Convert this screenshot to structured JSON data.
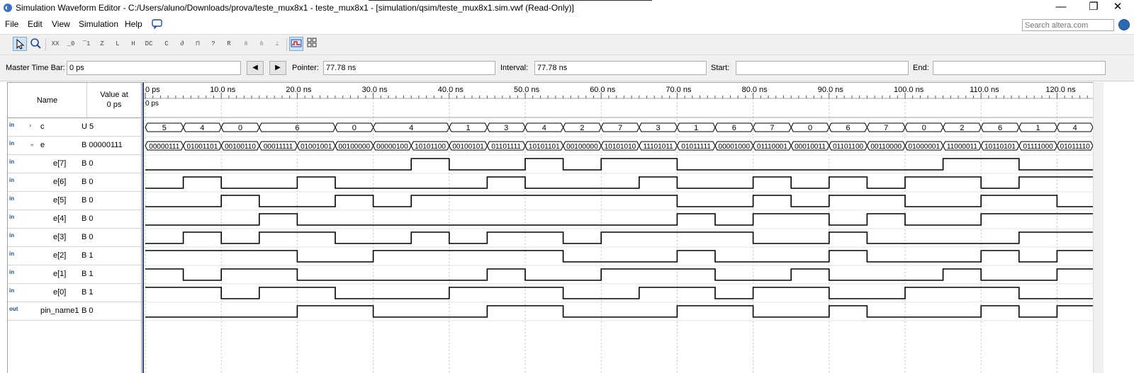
{
  "window": {
    "title": "Simulation Waveform Editor - C:/Users/aluno/Downloads/prova/teste_mux8x1 - teste_mux8x1 - [simulation/qsim/teste_mux8x1.sim.vwf (Read-Only)]",
    "minimize": "—",
    "maximize": "❐",
    "close": "✕"
  },
  "menu": [
    "File",
    "Edit",
    "View",
    "Simulation",
    "Help"
  ],
  "search_placeholder": "Search altera.com",
  "toolbar_icons": [
    "selection-tool",
    "zoom-tool",
    "force-unknown",
    "force-low",
    "force-high",
    "force-high-impedance",
    "force-weak-low",
    "force-weak-high",
    "force-dont-care",
    "invert",
    "count-value",
    "clock",
    "random-value",
    "arbitrary-value",
    "snap-to-grid",
    "snap-transitions",
    "grid-settings",
    "waveform-view",
    "tabular-view"
  ],
  "timebar": {
    "master_label": "Master Time Bar:",
    "master_value": "0 ps",
    "pointer_label": "Pointer:",
    "pointer_value": "77.78 ns",
    "interval_label": "Interval:",
    "interval_value": "77.78 ns",
    "start_label": "Start:",
    "start_value": "",
    "end_label": "End:",
    "end_value": ""
  },
  "columns": {
    "name": "Name",
    "value_line1": "Value at",
    "value_line2": "0 ps"
  },
  "time_ticks": [
    "0 ps",
    "10.0 ns",
    "20.0 ns",
    "30.0 ns",
    "40.0 ns",
    "50.0 ns",
    "60.0 ns",
    "70.0 ns",
    "80.0 ns",
    "90.0 ns",
    "100.0 ns",
    "110.0 ns",
    "120.0 ns"
  ],
  "cursor_label": "0 ps",
  "signals": [
    {
      "name": "c",
      "type": "in",
      "value": "U 5",
      "expand": "›",
      "kind": "bus",
      "segments": [
        "5",
        "4",
        "0",
        "6",
        "0",
        "4",
        "1",
        "3",
        "4",
        "2",
        "7",
        "3",
        "1",
        "6",
        "7",
        "0",
        "6",
        "7",
        "0",
        "2",
        "6",
        "1",
        "4"
      ],
      "widths": [
        1,
        1,
        1,
        2,
        1,
        2,
        1,
        1,
        1,
        1,
        1,
        1,
        1,
        1,
        1,
        1,
        1,
        1,
        1,
        1,
        1,
        1,
        1
      ]
    },
    {
      "name": "e",
      "type": "in",
      "value": "B 00000111",
      "expand": "⌄",
      "kind": "bus",
      "segments": [
        "00000111",
        "01001101",
        "00100110",
        "00011111",
        "01001001",
        "00100000",
        "00000100",
        "10101100",
        "00100101",
        "01101111",
        "10101101",
        "00100000",
        "10101010",
        "11101011",
        "01011111",
        "00001000",
        "01110001",
        "00010011",
        "01101100",
        "00110000",
        "01000001",
        "11000011",
        "10110101",
        "01111000",
        "01011110"
      ],
      "widths": [
        1,
        1,
        1,
        1,
        1,
        1,
        1,
        1,
        1,
        1,
        1,
        1,
        1,
        1,
        1,
        1,
        1,
        1,
        1,
        1,
        1,
        1,
        1,
        1,
        1
      ]
    },
    {
      "name": "e[7]",
      "type": "in",
      "value": "B 0",
      "kind": "bit",
      "bits": [
        0,
        0,
        0,
        0,
        0,
        0,
        0,
        1,
        0,
        0,
        1,
        0,
        1,
        1,
        0,
        0,
        0,
        0,
        0,
        0,
        0,
        1,
        1,
        0,
        0
      ]
    },
    {
      "name": "e[6]",
      "type": "in",
      "value": "B 0",
      "kind": "bit",
      "bits": [
        0,
        1,
        0,
        0,
        1,
        0,
        0,
        0,
        0,
        1,
        0,
        0,
        0,
        1,
        0,
        0,
        1,
        0,
        1,
        0,
        1,
        1,
        0,
        1,
        1
      ]
    },
    {
      "name": "e[5]",
      "type": "in",
      "value": "B 0",
      "kind": "bit",
      "bits": [
        0,
        0,
        1,
        0,
        0,
        1,
        0,
        1,
        1,
        1,
        1,
        1,
        1,
        1,
        0,
        0,
        1,
        0,
        1,
        1,
        0,
        0,
        1,
        1,
        0
      ]
    },
    {
      "name": "e[4]",
      "type": "in",
      "value": "B 0",
      "kind": "bit",
      "bits": [
        0,
        0,
        0,
        1,
        0,
        0,
        0,
        0,
        0,
        0,
        0,
        0,
        0,
        0,
        1,
        0,
        1,
        1,
        0,
        1,
        0,
        0,
        1,
        1,
        1
      ]
    },
    {
      "name": "e[3]",
      "type": "in",
      "value": "B 0",
      "kind": "bit",
      "bits": [
        0,
        1,
        0,
        1,
        1,
        0,
        0,
        1,
        0,
        1,
        1,
        0,
        1,
        1,
        1,
        1,
        0,
        0,
        1,
        0,
        0,
        0,
        0,
        1,
        1
      ]
    },
    {
      "name": "e[2]",
      "type": "in",
      "value": "B 1",
      "kind": "bit",
      "bits": [
        1,
        1,
        1,
        1,
        0,
        0,
        1,
        1,
        1,
        1,
        1,
        0,
        0,
        0,
        1,
        0,
        0,
        0,
        1,
        0,
        0,
        0,
        1,
        0,
        1
      ]
    },
    {
      "name": "e[1]",
      "type": "in",
      "value": "B 1",
      "kind": "bit",
      "bits": [
        1,
        0,
        1,
        1,
        0,
        0,
        0,
        0,
        0,
        1,
        0,
        0,
        1,
        1,
        1,
        0,
        0,
        1,
        0,
        0,
        0,
        1,
        0,
        0,
        1
      ]
    },
    {
      "name": "e[0]",
      "type": "in",
      "value": "B 1",
      "kind": "bit",
      "bits": [
        1,
        1,
        0,
        1,
        1,
        0,
        0,
        0,
        1,
        1,
        1,
        0,
        0,
        1,
        1,
        0,
        1,
        1,
        0,
        0,
        1,
        1,
        1,
        0,
        0
      ]
    },
    {
      "name": "pin_name1",
      "type": "out",
      "value": "B 0",
      "kind": "bit",
      "bits": [
        0,
        0,
        0,
        0,
        1,
        1,
        0,
        0,
        0,
        1,
        1,
        0,
        0,
        0,
        1,
        1,
        0,
        0,
        1,
        0,
        0,
        0,
        1,
        0,
        1
      ]
    }
  ],
  "colors": {
    "cursor": "#2e3db4",
    "wave": "#000000",
    "grid": "#c0c0c0",
    "icon": "#1f4e9e"
  }
}
